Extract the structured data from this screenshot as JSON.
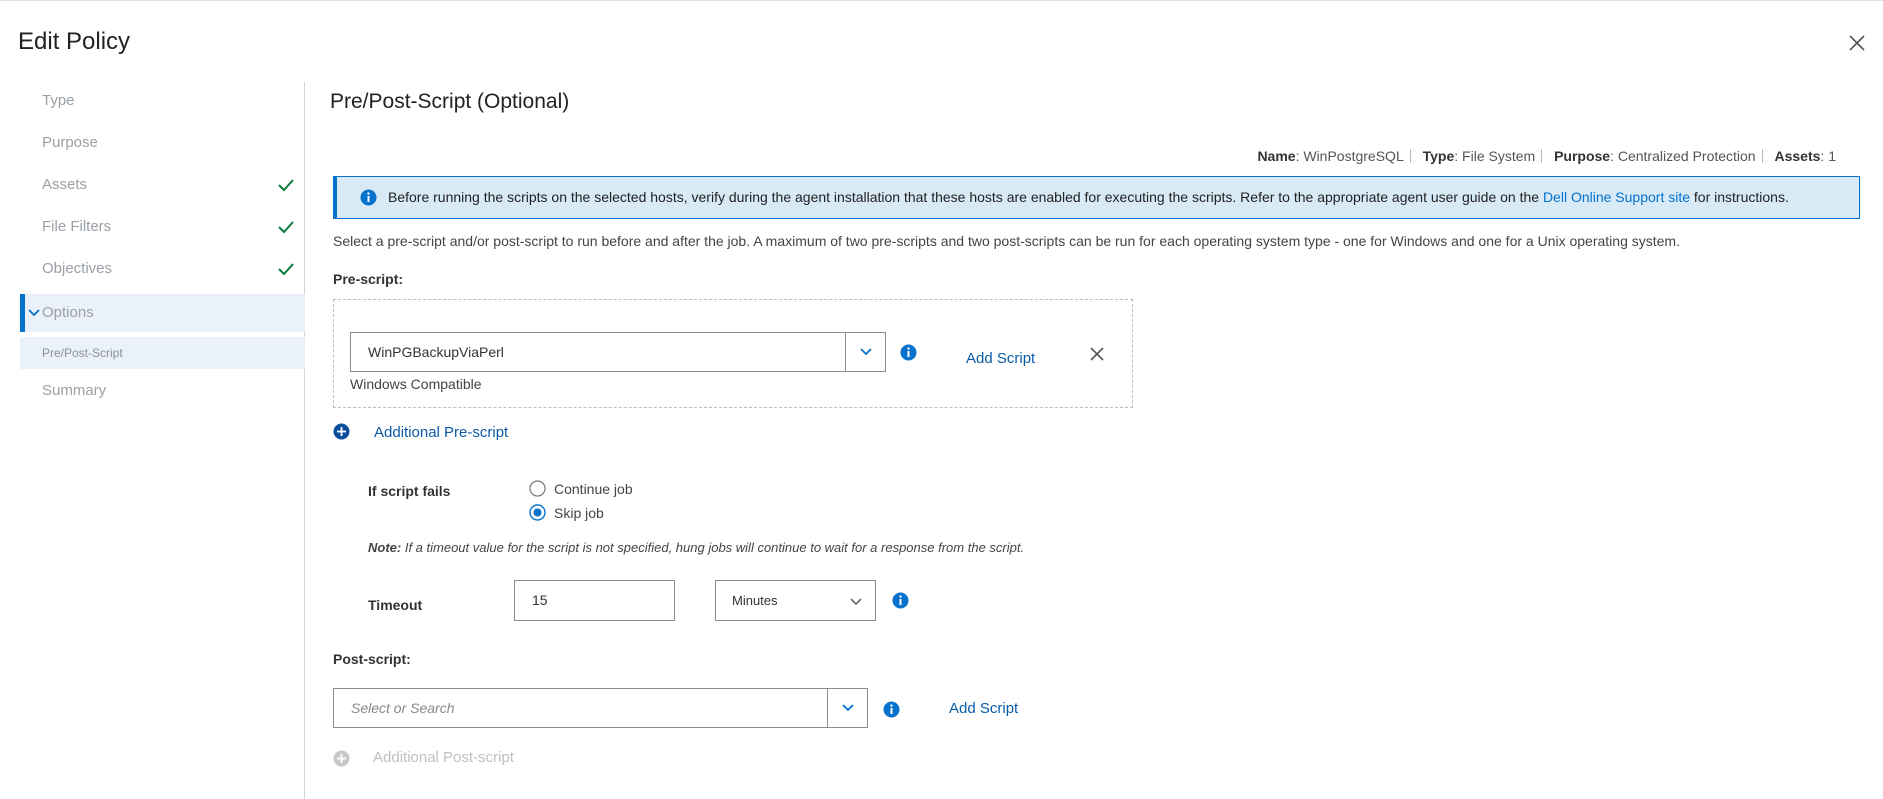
{
  "dialog": {
    "title": "Edit Policy"
  },
  "sidebar": {
    "steps": [
      {
        "label": "Type",
        "completed": false
      },
      {
        "label": "Purpose",
        "completed": false
      },
      {
        "label": "Assets",
        "completed": true
      },
      {
        "label": "File Filters",
        "completed": true
      },
      {
        "label": "Objectives",
        "completed": true
      },
      {
        "label": "Options",
        "active": true,
        "expanded": true
      },
      {
        "label": "Summary",
        "completed": false
      }
    ],
    "substep": {
      "label": "Pre/Post-Script"
    }
  },
  "main": {
    "title": "Pre/Post-Script (Optional)",
    "summary": {
      "name_label": "Name",
      "name_value": "WinPostgreSQL",
      "type_label": "Type",
      "type_value": "File System",
      "purpose_label": "Purpose",
      "purpose_value": "Centralized Protection",
      "assets_label": "Assets",
      "assets_value": "1"
    },
    "alert": {
      "text_before": "Before running the scripts on the selected hosts, verify during the agent installation that these hosts are enabled for executing the scripts. Refer to the appropriate agent user guide on the ",
      "link": "Dell Online Support site",
      "text_after": " for instructions."
    },
    "description": "Select a pre-script and/or post-script to run before and after the job. A maximum of two pre-scripts and two post-scripts can be run for each operating system type - one for Windows and one for a Unix operating system.",
    "pre_script": {
      "label": "Pre-script:",
      "selected": "WinPGBackupViaPerl",
      "compat": "Windows Compatible",
      "add_script": "Add Script",
      "additional": "Additional Pre-script"
    },
    "failure": {
      "label": "If script fails",
      "options": [
        {
          "label": "Continue job",
          "checked": false
        },
        {
          "label": "Skip job",
          "checked": true
        }
      ]
    },
    "note": {
      "prefix": "Note:",
      "text": " If a timeout value for the script is not specified, hung jobs will continue to wait for a response from the script."
    },
    "timeout": {
      "label": "Timeout",
      "value": "15",
      "unit": "Minutes"
    },
    "post_script": {
      "label": "Post-script:",
      "placeholder": "Select or Search",
      "add_script": "Add Script",
      "additional": "Additional Post-script"
    }
  },
  "colors": {
    "accent": "#0672cb",
    "success": "#0a7a3e",
    "alert_bg": "#d9eaf7"
  }
}
